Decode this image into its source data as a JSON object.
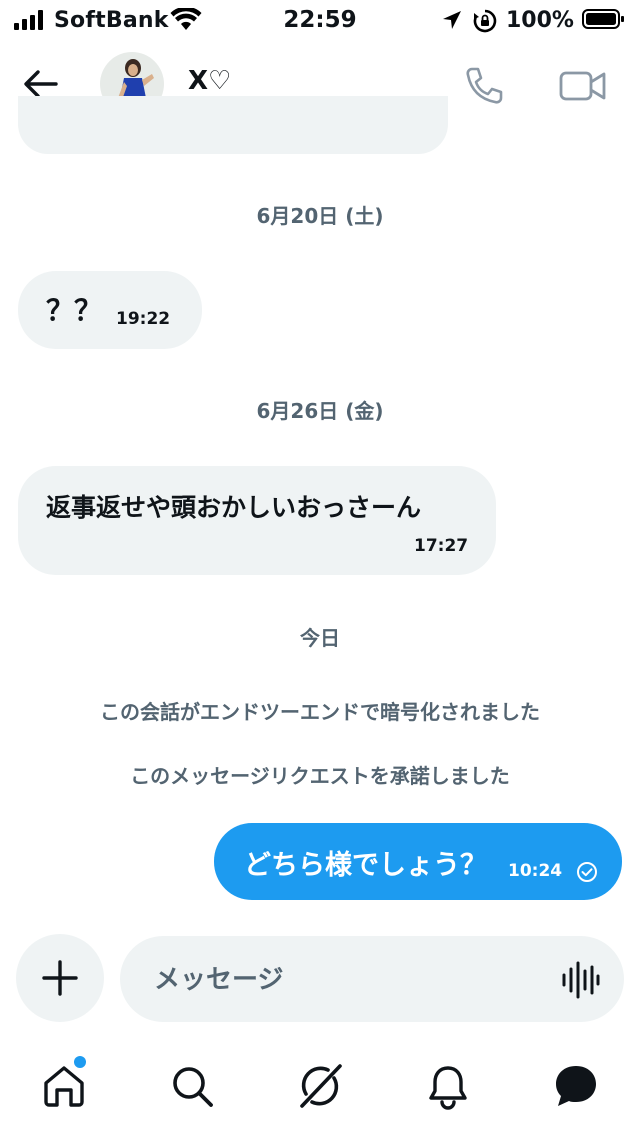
{
  "status_bar": {
    "carrier": "SoftBank",
    "time": "22:59",
    "battery_percent": "100%"
  },
  "header": {
    "contact_name": "X♡",
    "back_icon": "arrow-left-icon",
    "call_icon": "phone-icon",
    "video_icon": "video-camera-icon"
  },
  "messages": [
    {
      "type": "date",
      "text": "6月20日 (土)"
    },
    {
      "type": "incoming",
      "text": "？？",
      "time": "19:22"
    },
    {
      "type": "date",
      "text": "6月26日 (金)"
    },
    {
      "type": "incoming",
      "text": "返事返せや頭おかしいおっさーん",
      "time": "17:27"
    },
    {
      "type": "date",
      "text": "今日"
    },
    {
      "type": "system",
      "text": "この会話がエンドツーエンドで暗号化されました"
    },
    {
      "type": "system",
      "text": "このメッセージリクエストを承諾しました"
    },
    {
      "type": "outgoing",
      "text": "どちら様でしょう？",
      "time": "10:24",
      "status_icon": "check-circle-icon"
    }
  ],
  "composer": {
    "placeholder": "メッセージ",
    "add_icon": "plus-icon",
    "voice_icon": "waveform-icon"
  },
  "tab_bar": {
    "items": [
      "home-icon",
      "search-icon",
      "grok-icon",
      "bell-icon",
      "messages-icon"
    ],
    "home_has_notification": true
  },
  "colors": {
    "accent": "#1d9bf0",
    "bubble_in": "#eff3f4",
    "secondary_text": "#536471"
  }
}
